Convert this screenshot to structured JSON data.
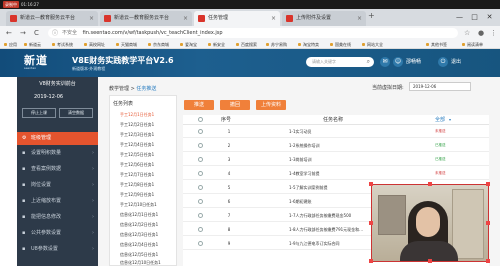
{
  "recording": {
    "badge": "录制中",
    "time": "01:16:27"
  },
  "browser": {
    "tabs": [
      {
        "label": "新道云—教育服务云平台"
      },
      {
        "label": "新道云—教育服务云平台"
      },
      {
        "label": "任务管理"
      },
      {
        "label": "上传附件及设置"
      }
    ],
    "new_tab": "+",
    "window_controls": {
      "minimize": "—",
      "maximize": "□",
      "close": "✕"
    },
    "nav": {
      "back": "←",
      "forward": "→",
      "reload": "C"
    },
    "address": {
      "security": "不安全",
      "url": "fin.seentao.com/v/wf/taskpush/vc_teachClient_index.jsp"
    },
    "bookmarks": [
      "应用",
      "新道云",
      "考试系统",
      "高校网址",
      "天猫商城",
      "京东商城",
      "爱淘宝",
      "新安全",
      "百度搜索",
      "苏宁易购",
      "淘宝特卖",
      "国美在线",
      "网站大全",
      "其他书签",
      "阅读清单"
    ]
  },
  "app": {
    "logo": "新道",
    "logo_sub": "seentao",
    "title": "V8E财务实践教学平台V2.6",
    "subtitle": "新道版本·外观教程",
    "search_placeholder": "请输入关键字",
    "user_name": "邵畅畅",
    "logout": "退出"
  },
  "sidebar": {
    "title": "V8财务实训前台",
    "date": "2019-12-06",
    "buttons": [
      "停止上课",
      "清空数据"
    ],
    "main_item": "班级管理",
    "items": [
      "设置明积数量",
      "查看案例数据",
      "岗位设置",
      "上近缩放布置",
      "能把信息修改",
      "公共参数设置",
      "U8参数设置"
    ]
  },
  "content": {
    "breadcrumb": {
      "parent": "教学管理",
      "sep": ">",
      "current": "任务推送"
    },
    "current_date_label": "当前虚拟日期:",
    "current_date": "2019-12-06",
    "task_list_head": "任务列表",
    "task_list": [
      "手工12月1日任务1",
      "手工12月2日任务1",
      "手工12月3日任务1",
      "手工12月4日任务1",
      "手工12月5日任务1",
      "手工12月6日任务1",
      "手工12月7日任务1",
      "手工12月8日任务1",
      "手工12月9日任务1",
      "手工12月10日任务1",
      "信息化12月1日任务1",
      "信息化12月2日任务1",
      "信息化12月3日任务1",
      "信息化12月4日任务1",
      "信息化12月5日任务1",
      "信息化12月10日任务1"
    ],
    "toolbar": {
      "push": "推送",
      "revoke": "撤回",
      "upload": "上传资料"
    },
    "table": {
      "headers": {
        "no": "序号",
        "name": "任务名称",
        "all": "全部"
      },
      "rows": [
        {
          "no": "1",
          "name": "1-1实习动员",
          "status": "未推送"
        },
        {
          "no": "2",
          "name": "1-2系统操作培训",
          "status": "已推送"
        },
        {
          "no": "3",
          "name": "1-3岗前培训",
          "status": "已推送"
        },
        {
          "no": "4",
          "name": "1-4教室学习前提",
          "status": "未推送"
        },
        {
          "no": "5",
          "name": "1-5了解实训案例前提",
          "status": "未推送"
        },
        {
          "no": "6",
          "name": "1-6期初建账",
          "status": "未推送"
        },
        {
          "no": "7",
          "name": "1-7人力行政部任务按缴费现金500",
          "status": "未推送"
        },
        {
          "no": "8",
          "name": "1-8人力行政部任务按缴费791元现金和...",
          "status": "未推送"
        },
        {
          "no": "9",
          "name": "1-9与九江德电币订实际合同",
          "status": "未推送"
        }
      ]
    }
  }
}
